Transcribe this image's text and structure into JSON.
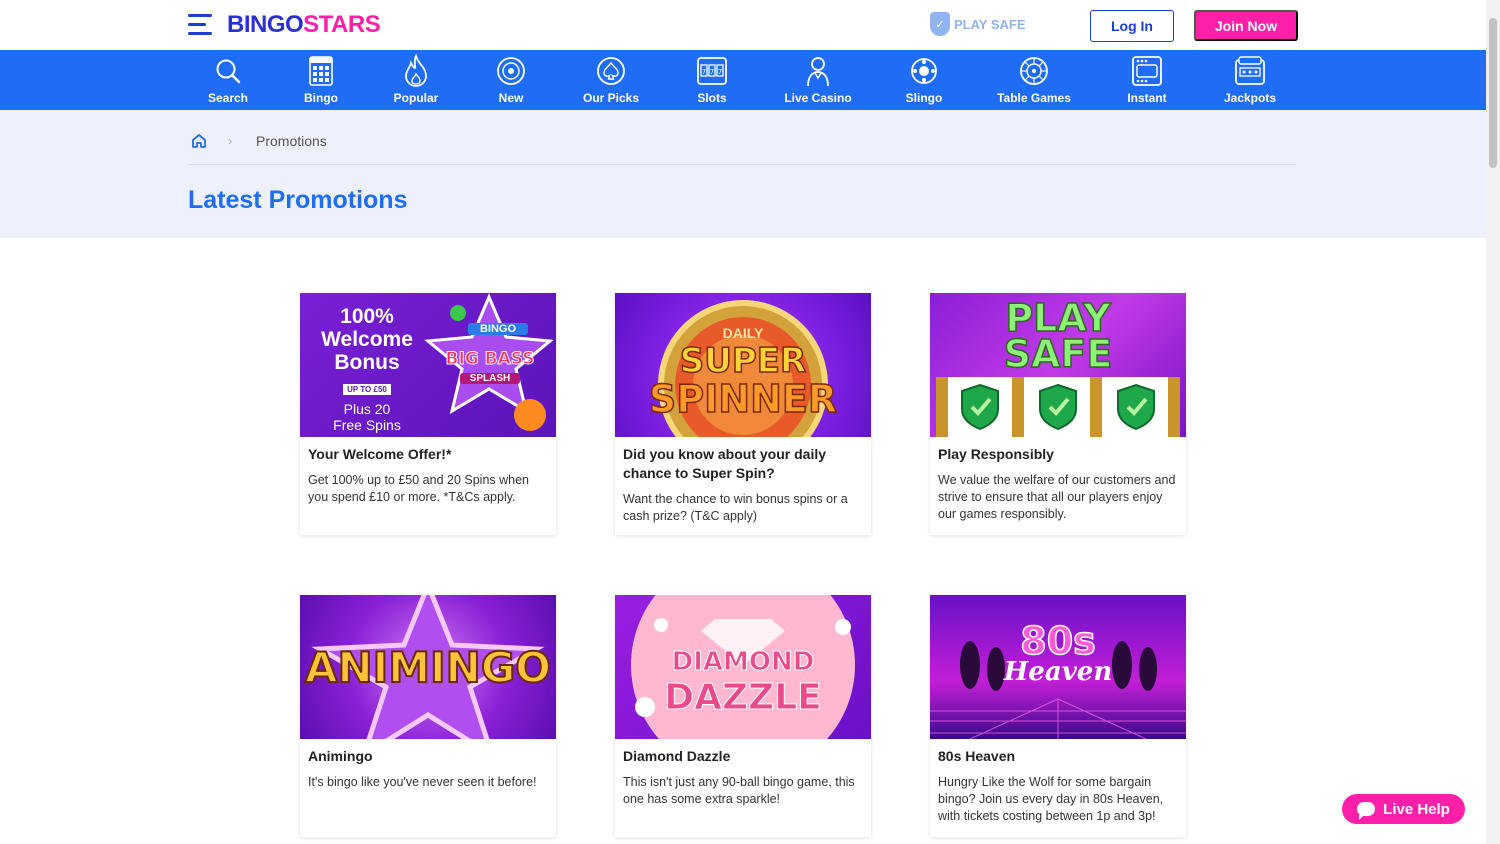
{
  "header": {
    "logo_a": "BINGO",
    "logo_b": "STARS",
    "play_safe": "PLAY SAFE",
    "login_label": "Log In",
    "join_label": "Join Now"
  },
  "categories": [
    {
      "label": "Search",
      "icon": "search-icon"
    },
    {
      "label": "Bingo",
      "icon": "bingo-card-icon"
    },
    {
      "label": "Popular",
      "icon": "flame-icon"
    },
    {
      "label": "New",
      "icon": "new-badge-icon"
    },
    {
      "label": "Our Picks",
      "icon": "spade-icon"
    },
    {
      "label": "Slots",
      "icon": "slot-machine-icon"
    },
    {
      "label": "Live Casino",
      "icon": "dealer-icon"
    },
    {
      "label": "Slingo",
      "icon": "slingo-ball-icon"
    },
    {
      "label": "Table Games",
      "icon": "roulette-icon"
    },
    {
      "label": "Instant",
      "icon": "scratch-card-icon"
    },
    {
      "label": "Jackpots",
      "icon": "jackpot-icon"
    }
  ],
  "breadcrumb": {
    "current": "Promotions"
  },
  "page_title": "Latest Promotions",
  "promotions": [
    {
      "title": "Your Welcome Offer!*",
      "description": "Get 100% up to £50 and 20 Spins when you spend £10 or more. *T&Cs apply.",
      "image_text": {
        "l1": "100%",
        "l2": "Welcome",
        "l3": "Bonus",
        "badge": "UP TO £50",
        "l4": "Plus 20",
        "l5": "Free Spins",
        "r1": "BINGO",
        "r2": "BIG BASS",
        "r3": "SPLASH"
      }
    },
    {
      "title": "Did you know about your daily chance to Super Spin?",
      "description": "Want the chance to win bonus spins or a cash prize? (T&C apply)",
      "image_text": {
        "l1": "DAILY",
        "l2": "SUPER",
        "l3": "SPINNER"
      }
    },
    {
      "title": "Play Responsibly",
      "description": "We value the welfare of our customers and strive to ensure that all our players enjoy our games responsibly.",
      "image_text": {
        "l1": "PLAY",
        "l2": "SAFE"
      }
    },
    {
      "title": "Animingo",
      "description": "It's bingo like you've never seen it before!",
      "image_text": {
        "l1": "ANIMINGO"
      }
    },
    {
      "title": "Diamond Dazzle",
      "description": "This isn't just any 90-ball bingo game, this one has some extra sparkle!",
      "image_text": {
        "l1": "DIAMOND",
        "l2": "DAZZLE"
      }
    },
    {
      "title": "80s Heaven",
      "description": "Hungry Like the Wolf for some bargain bingo? Join us every day in 80s Heaven, with tickets costing between 1p and 3p!",
      "image_text": {
        "l1": "80s",
        "l2": "Heaven"
      }
    }
  ],
  "live_help": "Live Help",
  "colors": {
    "brand_blue": "#1f6cf5",
    "brand_pink": "#ff1fa8",
    "logo_blue": "#2b2fd6"
  }
}
